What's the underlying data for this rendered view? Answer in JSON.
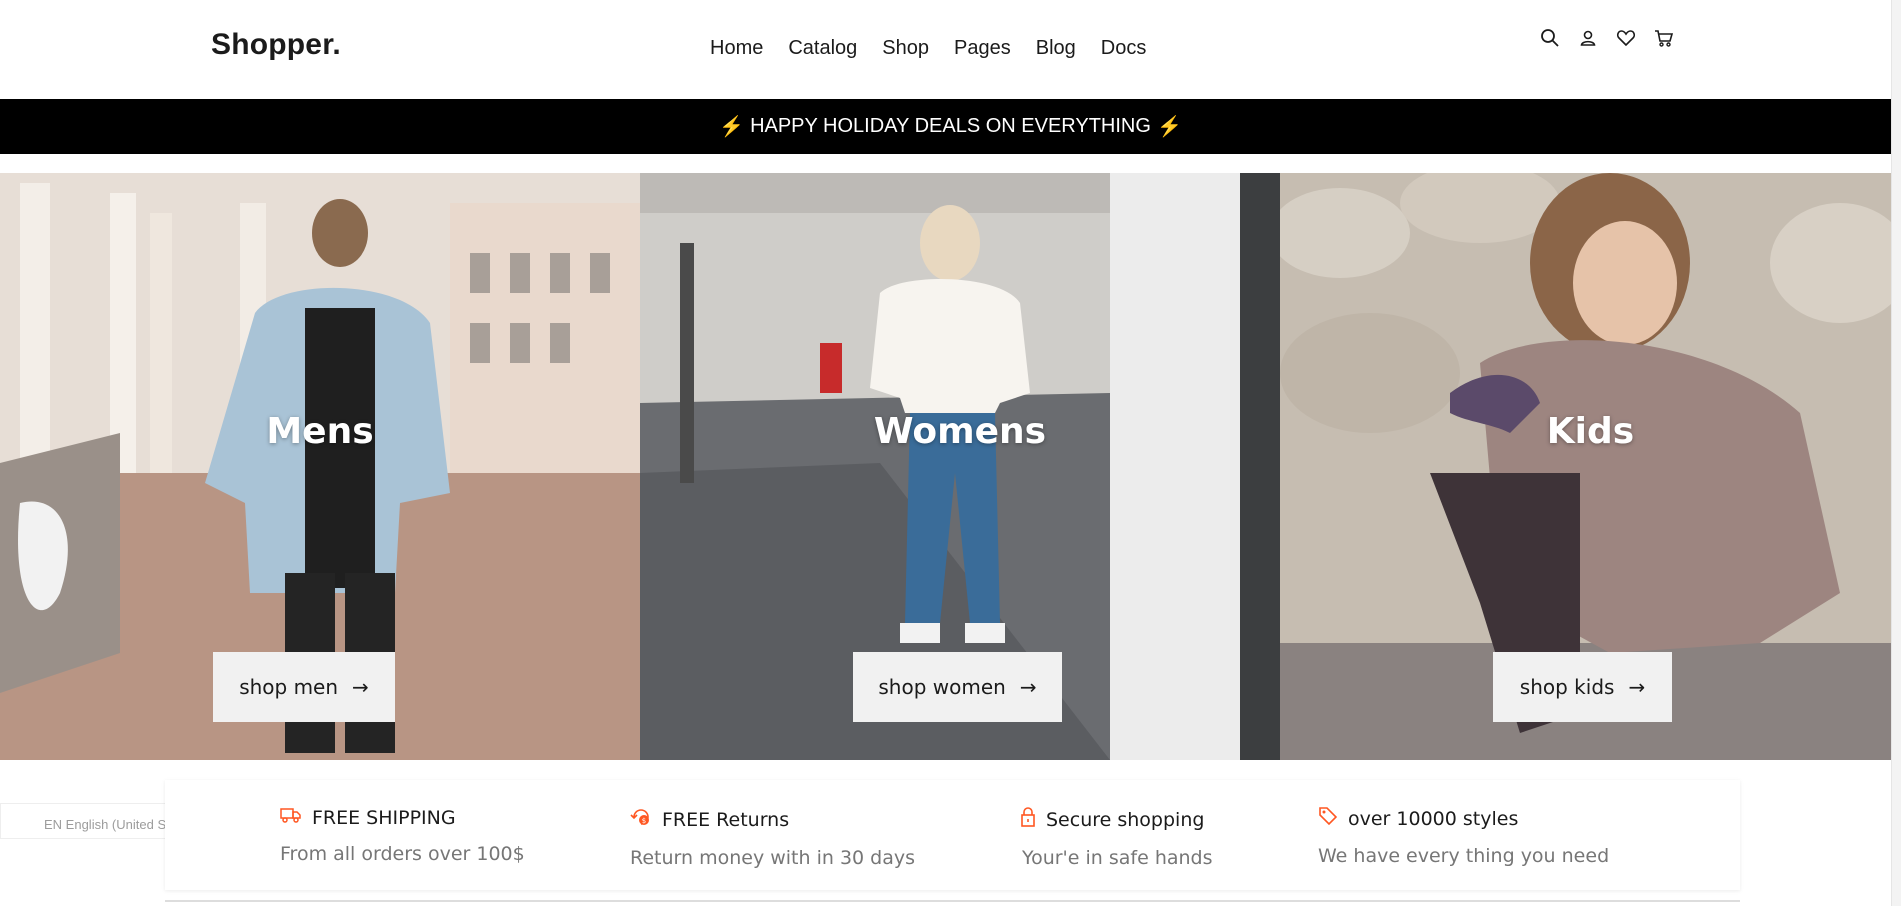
{
  "header": {
    "logo": "Shopper.",
    "nav": [
      "Home",
      "Catalog",
      "Shop",
      "Pages",
      "Blog",
      "Docs"
    ],
    "icons": [
      "search-icon",
      "user-icon",
      "heart-icon",
      "cart-icon"
    ]
  },
  "promo": {
    "text": "HAPPY HOLIDAY DEALS ON EVERYTHING",
    "bolt": "⚡"
  },
  "hero": {
    "panels": [
      {
        "title": "Mens",
        "button": "shop men"
      },
      {
        "title": "Womens",
        "button": "shop women"
      },
      {
        "title": "Kids",
        "button": "shop kids"
      }
    ],
    "arrow": "→"
  },
  "features": [
    {
      "title": "FREE SHIPPING",
      "subtitle": "From all orders over 100$",
      "icon": "truck-icon"
    },
    {
      "title": "FREE Returns",
      "subtitle": "Return money with in 30 days",
      "icon": "refund-icon"
    },
    {
      "title": "Secure shopping",
      "subtitle": "Your'e in safe hands",
      "icon": "lock-icon"
    },
    {
      "title": "over 10000 styles",
      "subtitle": "We have every thing you need",
      "icon": "tag-icon"
    }
  ],
  "language": {
    "selected": "EN English (United States)"
  },
  "colors": {
    "accent": "#ff5722",
    "promo_bg": "#000000",
    "bolt": "#f7c600"
  }
}
